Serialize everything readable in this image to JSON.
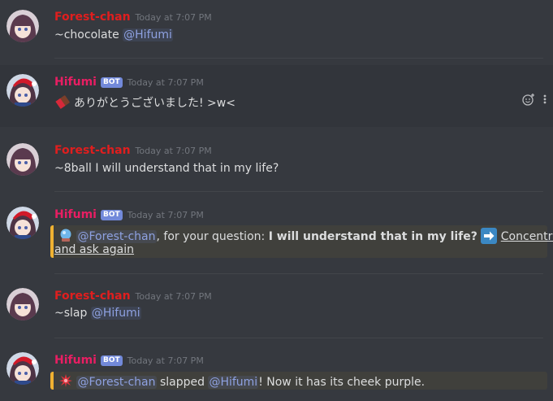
{
  "messages": [
    {
      "user": "Forest-chan",
      "timestamp": "Today at 7:07 PM",
      "text": "~chocolate ",
      "mention": "@Hifumi"
    },
    {
      "user": "Hifumi",
      "badge": "BOT",
      "timestamp": "Today at 7:07 PM",
      "text": "ありがとうございました! >w<"
    },
    {
      "user": "Forest-chan",
      "timestamp": "Today at 7:07 PM",
      "text": "~8ball I will understand that in my life?"
    },
    {
      "user": "Hifumi",
      "badge": "BOT",
      "timestamp": "Today at 7:07 PM",
      "embed": {
        "mention": "@Forest-chan",
        "text1": ", for your question: ",
        "bold": "I will understand that in my life?",
        "link_line1": "Concentrate",
        "link_line2": "and ask again"
      }
    },
    {
      "user": "Forest-chan",
      "timestamp": "Today at 7:07 PM",
      "text": "~slap ",
      "mention": "@Hifumi"
    },
    {
      "user": "Hifumi",
      "badge": "BOT",
      "timestamp": "Today at 7:07 PM",
      "embed": {
        "mention1": "@Forest-chan",
        "text1": " slapped ",
        "mention2": "@Hifumi",
        "text2": "! Now it has its cheek purple."
      }
    }
  ],
  "icons": {
    "reaction": "add-reaction-icon",
    "more": "more-options-icon"
  },
  "colors": {
    "bg": "#36393f",
    "forest": "#e01e1e",
    "hifumi": "#e91e63",
    "embed_border": "#f0b232",
    "mention": "#8ea1e1"
  }
}
